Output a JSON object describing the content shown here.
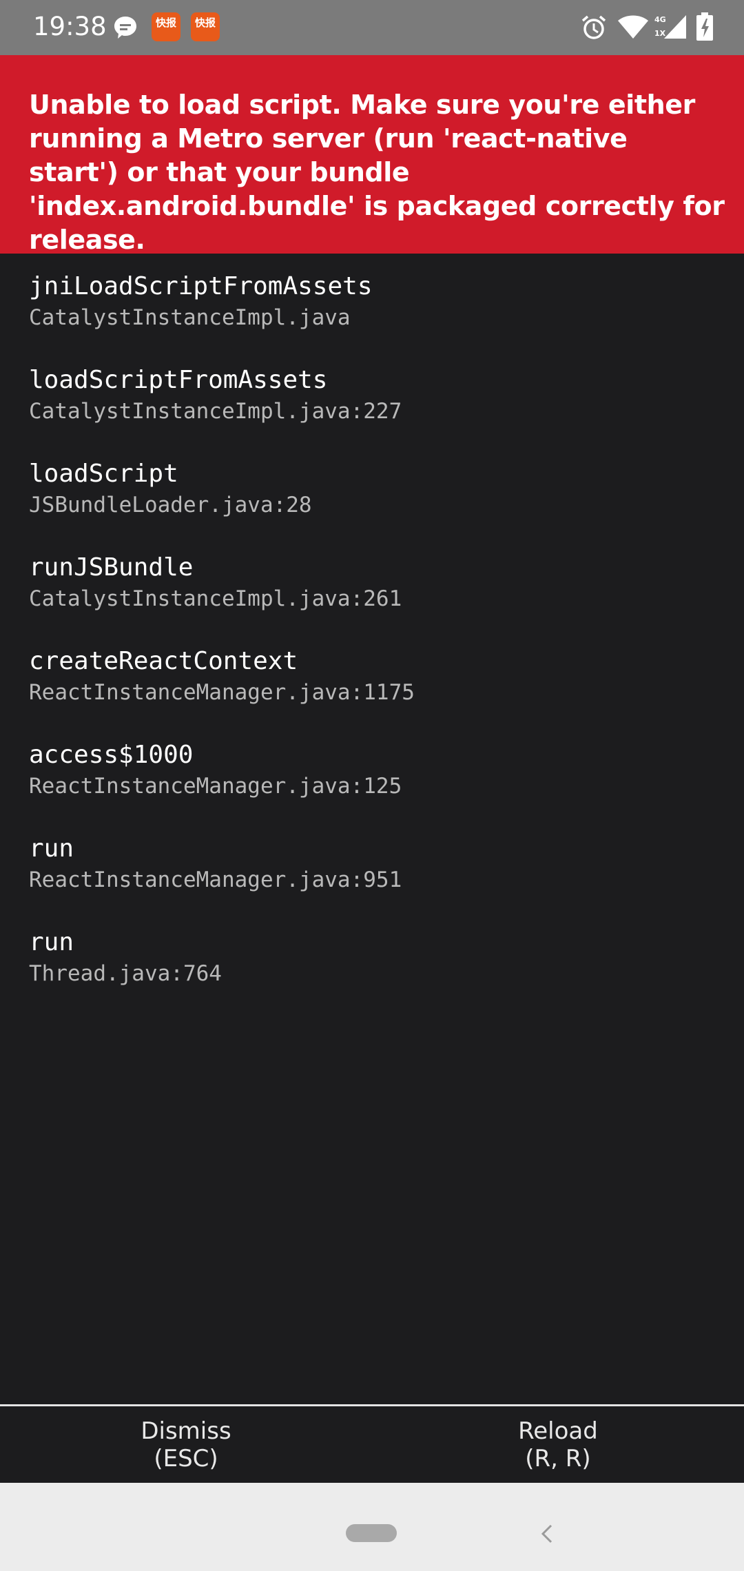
{
  "status_bar": {
    "time": "19:38",
    "notification_icons": [
      "message-bubble-icon",
      "news-app-icon",
      "news-app-icon"
    ],
    "app_icon_label": "快报",
    "network_label_top": "4G",
    "network_label_bottom": "1X",
    "right_icons": [
      "alarm-icon",
      "wifi-icon",
      "signal-icon",
      "battery-charging-icon"
    ]
  },
  "error": {
    "message": "Unable to load script. Make sure you're either running a Metro server (run 'react-native start') or that your bundle 'index.android.bundle' is packaged correctly for release.",
    "background_color": "#d01b2a"
  },
  "stack": [
    {
      "method": "jniLoadScriptFromAssets",
      "file": "CatalystInstanceImpl.java"
    },
    {
      "method": "loadScriptFromAssets",
      "file": "CatalystInstanceImpl.java:227"
    },
    {
      "method": "loadScript",
      "file": "JSBundleLoader.java:28"
    },
    {
      "method": "runJSBundle",
      "file": "CatalystInstanceImpl.java:261"
    },
    {
      "method": "createReactContext",
      "file": "ReactInstanceManager.java:1175"
    },
    {
      "method": "access$1000",
      "file": "ReactInstanceManager.java:125"
    },
    {
      "method": "run",
      "file": "ReactInstanceManager.java:951"
    },
    {
      "method": "run",
      "file": "Thread.java:764"
    }
  ],
  "buttons": {
    "dismiss": {
      "label": "Dismiss",
      "shortcut": "(ESC)"
    },
    "reload": {
      "label": "Reload",
      "shortcut": "(R, R)"
    }
  },
  "nav_bar": {
    "icons": [
      "home-pill-icon",
      "back-chevron-icon"
    ]
  }
}
